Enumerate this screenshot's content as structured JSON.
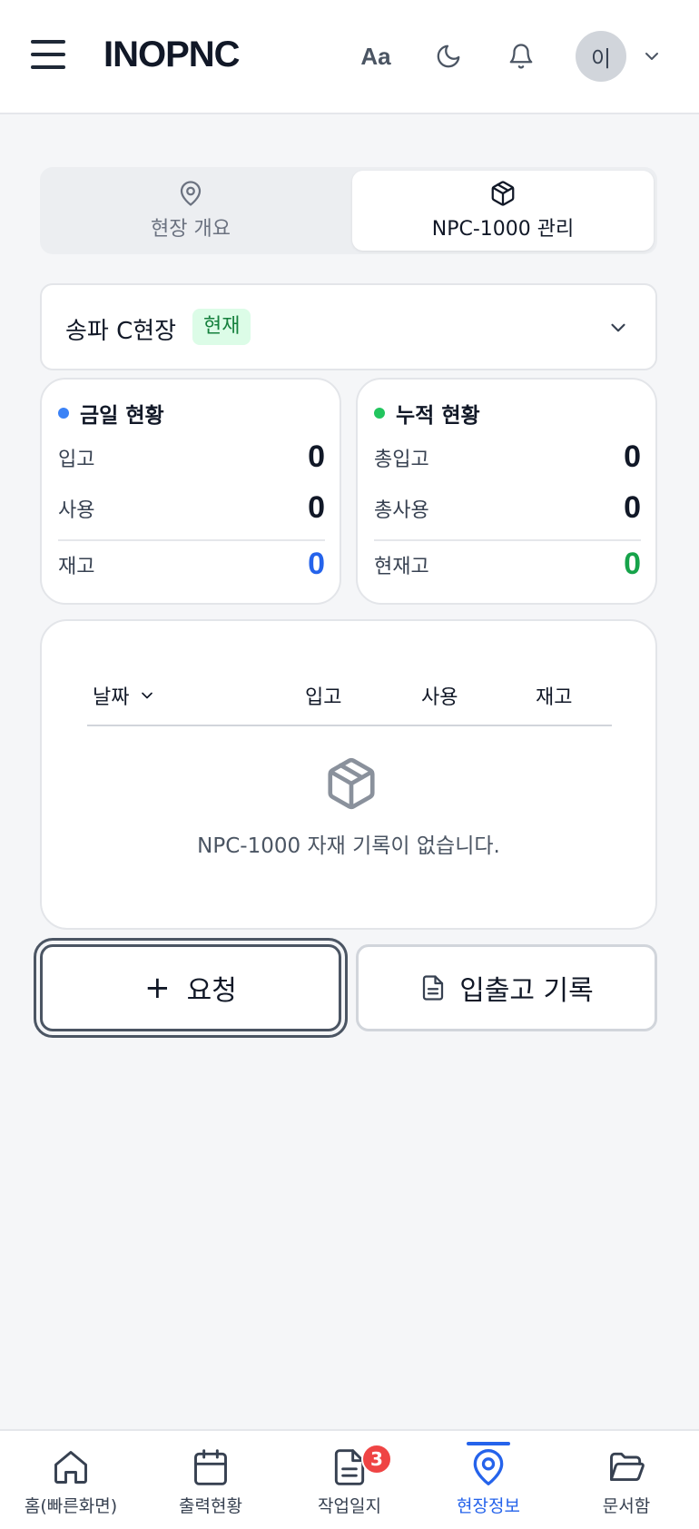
{
  "header": {
    "title": "INOPNC",
    "font_size_label": "Aa",
    "avatar_initial": "이",
    "icons": [
      "menu-icon",
      "font-size-icon",
      "moon-icon",
      "bell-icon",
      "chevron-down-icon"
    ]
  },
  "tabs": [
    {
      "label": "현장 개요",
      "icon": "map-pin-icon",
      "active": false
    },
    {
      "label": "NPC-1000 관리",
      "icon": "package-icon",
      "active": true
    }
  ],
  "site": {
    "name": "송파 C현장",
    "badge": "현재",
    "badge_color": "#15803d"
  },
  "today": {
    "title": "금일 현황",
    "dot_color": "#3b82f6",
    "rows": [
      {
        "label": "입고",
        "value": "0"
      },
      {
        "label": "사용",
        "value": "0"
      },
      {
        "label": "재고",
        "value": "0"
      }
    ],
    "stock_color": "#2563eb"
  },
  "total": {
    "title": "누적 현황",
    "dot_color": "#22c55e",
    "rows": [
      {
        "label": "총입고",
        "value": "0"
      },
      {
        "label": "총사용",
        "value": "0"
      },
      {
        "label": "현재고",
        "value": "0"
      }
    ],
    "stock_color": "#16a34a"
  },
  "table": {
    "headers": [
      "날짜",
      "입고",
      "사용",
      "재고"
    ],
    "empty_text": "NPC-1000 자재 기록이 없습니다."
  },
  "actions": {
    "request_plus": "+",
    "request_label": "요청",
    "record_label": "입출고 기록"
  },
  "nav": [
    {
      "label": "홈(빠른화면)",
      "icon": "home-icon"
    },
    {
      "label": "출력현황",
      "icon": "calendar-icon"
    },
    {
      "label": "작업일지",
      "icon": "document-icon",
      "badge": "3"
    },
    {
      "label": "현장정보",
      "icon": "map-pin-icon",
      "active": true
    },
    {
      "label": "문서함",
      "icon": "folder-icon"
    }
  ],
  "colors": {
    "accent": "#2563eb",
    "badge_red": "#ef4444"
  }
}
